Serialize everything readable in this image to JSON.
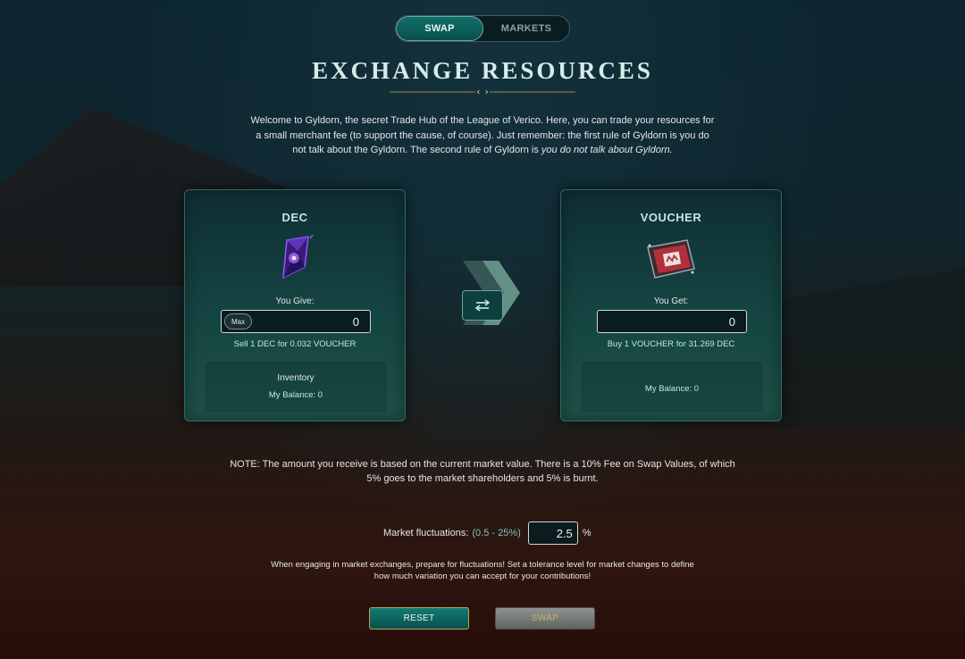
{
  "tabs": {
    "swap": "SWAP",
    "markets": "MARKETS"
  },
  "title": "EXCHANGE RESOURCES",
  "intro": {
    "text": "Welcome to Gyldorn, the secret Trade Hub of the League of Verico. Here, you can trade your resources for a small merchant fee (to support the cause, of course). Just remember: the first rule of Gyldorn is you do not talk about the Gyldorn. The second rule of Gyldorn is ",
    "emphasis": "you do not talk about Gyldorn."
  },
  "give": {
    "resource": "DEC",
    "icon": "dec-crystal-icon",
    "label": "You Give:",
    "max_label": "Max",
    "amount": "0",
    "rate": "Sell 1 DEC for 0.032 VOUCHER",
    "inventory_title": "Inventory",
    "balance": "My Balance: 0"
  },
  "get": {
    "resource": "VOUCHER",
    "icon": "voucher-ticket-icon",
    "label": "You Get:",
    "amount": "0",
    "rate": "Buy 1 VOUCHER for 31.269 DEC",
    "balance": "My Balance: 0"
  },
  "note": "NOTE: The amount you receive is based on the current market value. There is a 10% Fee on Swap Values, of which 5% goes to the market shareholders and 5% is burnt.",
  "fluctuation": {
    "label": "Market fluctuations:",
    "range": "(0.5 - 25%)",
    "value": "2.5",
    "unit": "%"
  },
  "tolerance_text": "When engaging in market exchanges, prepare for fluctuations! Set a tolerance level for market changes to define how much variation you can accept for your contributions!",
  "buttons": {
    "reset": "RESET",
    "swap": "SWAP"
  },
  "colors": {
    "accent": "#0f6f6a",
    "card": "#154542",
    "gold": "#c9b26a"
  }
}
